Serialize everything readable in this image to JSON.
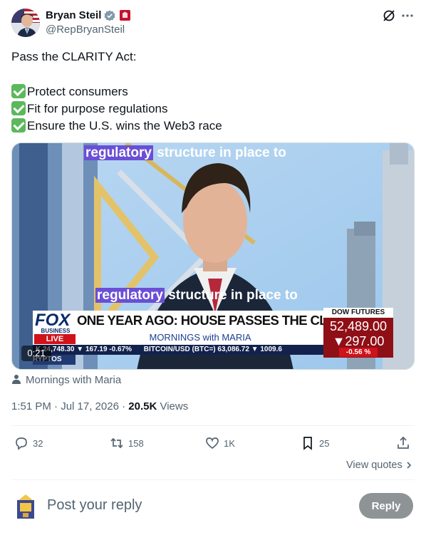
{
  "author": {
    "name": "Bryan Steil",
    "handle": "@RepBryanSteil",
    "verified_icon": "verified-badge-icon",
    "affiliation_icon": "government-affiliation-icon"
  },
  "tweet": {
    "intro": "Pass the CLARITY Act:",
    "bullets": [
      "Protect consumers",
      "Fit for purpose regulations",
      "Ensure the U.S. wins the Web3 race"
    ],
    "bullet_icon": "check-mark-button-emoji"
  },
  "video": {
    "caption_highlight": "regulatory",
    "caption_rest": " structure in place to",
    "network": "FOX",
    "network_sub": "BUSINESS",
    "live_label": "LIVE",
    "headline": "ONE YEAR AGO: HOUSE PASSES THE CLARITY ACT",
    "show": "MORNINGS with MARIA",
    "ticker_left": "K 24,748.30 ▼ 167.19 -0.67%",
    "ticker_crypto": "RYPTOS",
    "ticker_bitcoin": "BITCOIN/USD (BTC=) 63,086.72 ▼ 1009.6",
    "dow_label": "DOW FUTURES",
    "dow_value": "52,489.00",
    "dow_change": "▼297.00",
    "dow_pct": "-0.56 %",
    "duration": "0:21"
  },
  "source_label": "Mornings with Maria",
  "meta": {
    "time": "1:51 PM · Jul 17, 2026 · ",
    "views_count": "20.5K",
    "views_label": " Views"
  },
  "actions": {
    "replies": "32",
    "reposts": "158",
    "likes": "1K",
    "bookmarks": "25"
  },
  "view_quotes": "View quotes",
  "reply_placeholder": "Post your reply",
  "reply_button": "Reply"
}
